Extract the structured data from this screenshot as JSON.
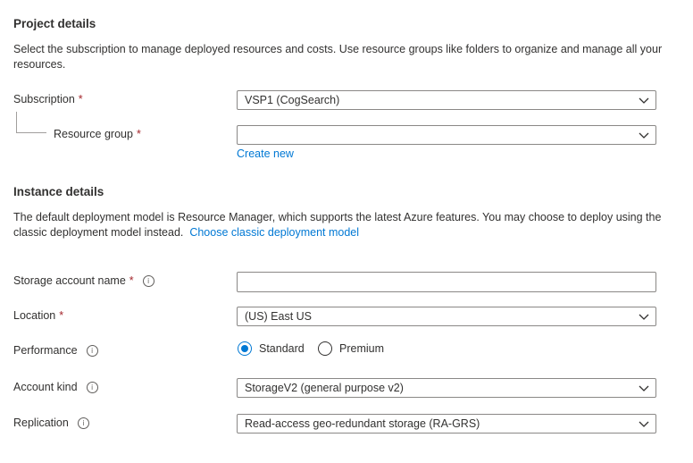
{
  "project": {
    "title": "Project details",
    "description": "Select the subscription to manage deployed resources and costs. Use resource groups like folders to organize and manage all your resources.",
    "subscription_label": "Subscription",
    "subscription_value": "VSP1 (CogSearch)",
    "resource_group_label": "Resource group",
    "resource_group_value": "",
    "create_new": "Create new"
  },
  "instance": {
    "title": "Instance details",
    "description": "The default deployment model is Resource Manager, which supports the latest Azure features. You may choose to deploy using the classic deployment model instead.",
    "classic_link": "Choose classic deployment model",
    "storage_name_label": "Storage account name",
    "storage_name_value": "",
    "location_label": "Location",
    "location_value": "(US) East US",
    "performance_label": "Performance",
    "performance_options": [
      "Standard",
      "Premium"
    ],
    "performance_selected": "Standard",
    "account_kind_label": "Account kind",
    "account_kind_value": "StorageV2 (general purpose v2)",
    "replication_label": "Replication",
    "replication_value": "Read-access geo-redundant storage (RA-GRS)"
  },
  "required_marker": "*",
  "info_glyph": "i",
  "colors": {
    "accent": "#0078d4",
    "required": "#a4262c",
    "border": "#8a8886",
    "text": "#323130"
  }
}
